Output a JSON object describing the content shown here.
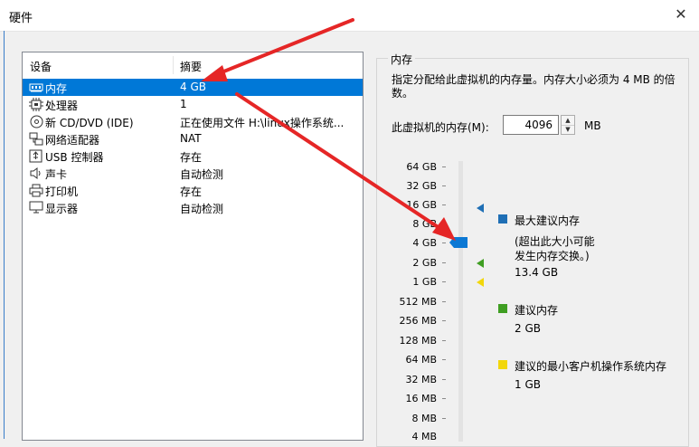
{
  "window": {
    "title": "硬件",
    "close_glyph": "✕"
  },
  "device_list": {
    "headers": {
      "device": "设备",
      "summary": "摘要"
    },
    "rows": [
      {
        "label": "内存",
        "summary": "4 GB",
        "icon": "memory-icon"
      },
      {
        "label": "处理器",
        "summary": "1",
        "icon": "processor-icon"
      },
      {
        "label": "新 CD/DVD (IDE)",
        "summary": "正在使用文件 H:\\linux操作系统...",
        "icon": "cd-dvd-icon"
      },
      {
        "label": "网络适配器",
        "summary": "NAT",
        "icon": "network-adapter-icon"
      },
      {
        "label": "USB 控制器",
        "summary": "存在",
        "icon": "usb-controller-icon"
      },
      {
        "label": "声卡",
        "summary": "自动检测",
        "icon": "sound-card-icon"
      },
      {
        "label": "打印机",
        "summary": "存在",
        "icon": "printer-icon"
      },
      {
        "label": "显示器",
        "summary": "自动检测",
        "icon": "display-icon"
      }
    ]
  },
  "memory": {
    "group_title": "内存",
    "description": "指定分配给此虚拟机的内存量。内存大小必须为 4 MB 的倍数。",
    "input_label": "此虚拟机的内存(M):",
    "input_value": "4096",
    "unit": "MB",
    "scale_labels": [
      "64 GB",
      "32 GB",
      "16 GB",
      "8 GB",
      "4 GB",
      "2 GB",
      "1 GB",
      "512 MB",
      "256 MB",
      "128 MB",
      "64 MB",
      "32 MB",
      "16 MB",
      "8 MB",
      "4 MB"
    ],
    "selected_value": "4 GB",
    "legend": {
      "max_title": "最大建议内存",
      "max_note_line1": "(超出此大小可能",
      "max_note_line2": "发生内存交换。)",
      "max_value": "13.4 GB",
      "rec_title": "建议内存",
      "rec_value": "2 GB",
      "min_title": "建议的最小客户机操作系统内存",
      "min_value": "1 GB"
    },
    "colors": {
      "max": "#1f6fb5",
      "recommended": "#3f9e22",
      "minimum": "#f2d70b",
      "thumb": "#0b78d4"
    }
  },
  "annotation": {
    "arrow_color": "#e52626"
  }
}
